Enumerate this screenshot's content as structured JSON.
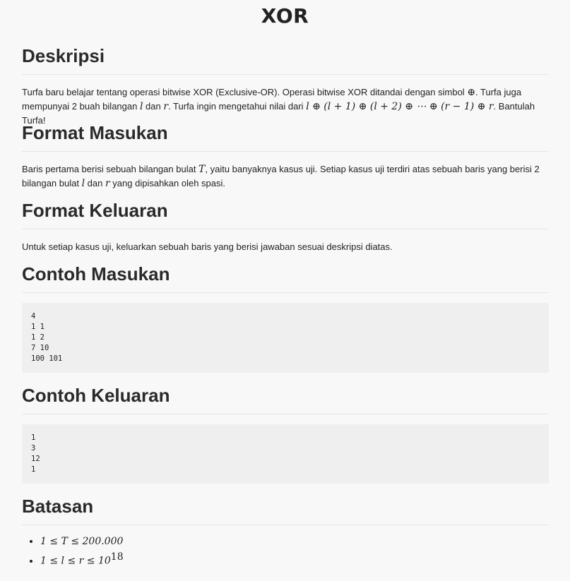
{
  "title": "XOR",
  "sections": {
    "deskripsi": {
      "heading": "Deskripsi",
      "t1": "Turfa baru belajar tentang operasi bitwise XOR (Exclusive-OR). Operasi bitwise XOR ditandai dengan simbol ",
      "sym": "⊕",
      "t2": ". Turfa juga mempunyai 2 buah bilangan ",
      "l": "l",
      "t3": " dan ",
      "r": "r",
      "t4": ". Turfa ingin mengetahui nilai dari ",
      "expr": "l ⊕ (l + 1) ⊕ (l + 2) ⊕ ⋯ ⊕ (r − 1) ⊕ r",
      "t5": ". Bantulah Turfa!"
    },
    "format_masukan": {
      "heading": "Format Masukan",
      "t1": "Baris pertama berisi sebuah bilangan bulat ",
      "T": "T",
      "t2": ", yaitu banyaknya kasus uji. Setiap kasus uji terdiri atas sebuah baris yang berisi 2 bilangan bulat ",
      "l": "l",
      "t3": " dan ",
      "r": "r",
      "t4": " yang dipisahkan oleh spasi."
    },
    "format_keluaran": {
      "heading": "Format Keluaran",
      "text": "Untuk setiap kasus uji, keluarkan sebuah baris yang berisi jawaban sesuai deskripsi diatas."
    },
    "contoh_masukan": {
      "heading": "Contoh Masukan",
      "code": "4\n1 1\n1 2\n7 10\n100 101"
    },
    "contoh_keluaran": {
      "heading": "Contoh Keluaran",
      "code": "1\n3\n12\n1"
    },
    "batasan": {
      "heading": "Batasan",
      "c1": "1 ≤ T ≤ 200.000",
      "c2": "1 ≤ l ≤ r ≤ 10",
      "c2_exp": "18"
    }
  }
}
